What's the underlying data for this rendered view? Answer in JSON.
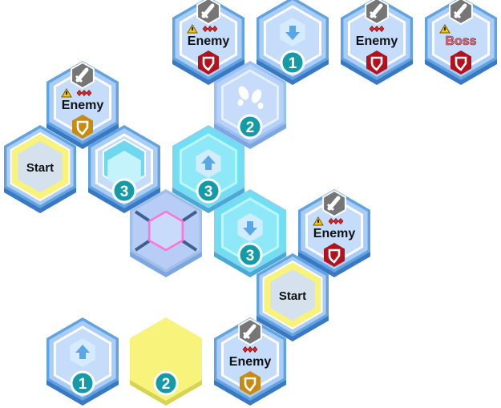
{
  "labels": {
    "enemy": "Enemy",
    "boss": "Boss",
    "start": "Start"
  },
  "colors": {
    "rim": "#5fa3e0",
    "rim_shadow": "#3b78c4",
    "face": "#a9cdf8",
    "face_inner": "#c5ddfb",
    "cyan_face": "#6fe0f4",
    "yellow": "#f8f37a",
    "yellow_shadow": "#d7d454",
    "badge_teal": "#159aa8",
    "shield_red": "#b3121c",
    "shield_gold": "#c98a10",
    "sword_grey": "#767676",
    "selected_pink": "#ff74d6"
  },
  "tiles": [
    {
      "id": "t-top-1",
      "kind": "enemy",
      "label": "enemy",
      "warn": true,
      "diamonds": 3,
      "shield": "red"
    },
    {
      "id": "t-top-2",
      "kind": "blue",
      "icon": "arrow-down",
      "badge": "1"
    },
    {
      "id": "t-top-3",
      "kind": "enemy",
      "label": "enemy",
      "warn": false,
      "diamonds": 3,
      "shield": "red"
    },
    {
      "id": "t-top-4",
      "kind": "enemy",
      "label": "boss",
      "warn": true,
      "diamonds": 0,
      "shield": "red"
    },
    {
      "id": "t-left-enemy",
      "kind": "enemy",
      "label": "enemy",
      "warn": true,
      "diamonds": 3,
      "shield": "gold"
    },
    {
      "id": "t-footsteps",
      "kind": "light",
      "icon": "footsteps",
      "badge": "2"
    },
    {
      "id": "t-start-1",
      "kind": "start",
      "label": "start"
    },
    {
      "id": "t-up-3",
      "kind": "blue",
      "icon": "up-tile",
      "badge": "3"
    },
    {
      "id": "t-cyan-up",
      "kind": "cyan",
      "icon": "arrow-up",
      "badge": "3"
    },
    {
      "id": "t-selected",
      "kind": "selected"
    },
    {
      "id": "t-cyan-down",
      "kind": "cyan",
      "icon": "arrow-down",
      "badge": "3"
    },
    {
      "id": "t-right-enemy",
      "kind": "enemy",
      "label": "enemy",
      "warn": true,
      "diamonds": 3,
      "shield": "red"
    },
    {
      "id": "t-start-2",
      "kind": "start",
      "label": "start"
    },
    {
      "id": "t-bottom-1",
      "kind": "blue",
      "icon": "arrow-up",
      "badge": "1"
    },
    {
      "id": "t-bottom-2",
      "kind": "yellow",
      "badge": "2"
    },
    {
      "id": "t-bottom-enemy",
      "kind": "enemy",
      "label": "enemy",
      "warn": false,
      "diamonds": 3,
      "shield": "gold"
    }
  ]
}
